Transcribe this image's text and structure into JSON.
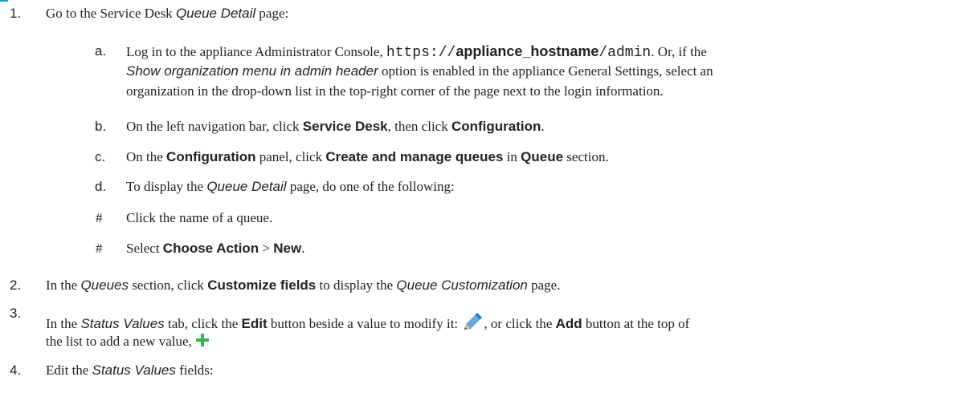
{
  "steps": {
    "s1": {
      "num": "1.",
      "text_a": "Go to the Service Desk ",
      "text_b": "Queue Detail",
      "text_c": " page:"
    },
    "a": {
      "label": "a.",
      "l1_a": "Log in to the appliance Administrator Console, ",
      "l1_url1": "https://",
      "l1_url2": "appliance_hostname",
      "l1_url3": "/admin",
      "l1_b": ". Or, if the",
      "l2_a": "Show organization menu in admin header",
      "l2_b": " option is enabled in the appliance General Settings, select an",
      "l3": "organization in the drop-down list in the top-right corner of the page next to the login information."
    },
    "b": {
      "label": "b.",
      "t1": "On the left navigation bar, click ",
      "t2": "Service Desk",
      "t3": ", then click ",
      "t4": "Configuration",
      "t5": "."
    },
    "c": {
      "label": "c.",
      "t1": "On the ",
      "t2": "Configuration",
      "t3": " panel, click ",
      "t4": "Create and manage queues",
      "t5": " in ",
      "t6": "Queue",
      "t7": " section."
    },
    "d": {
      "label": "d.",
      "t1": "To display the ",
      "t2": "Queue Detail",
      "t3": " page, do one of the following:"
    },
    "bullet1": {
      "mark": "#",
      "text": "Click the name of a queue."
    },
    "bullet2": {
      "mark": "#",
      "t1": "Select ",
      "t2": "Choose Action",
      "t3": " > ",
      "t4": "New",
      "t5": "."
    },
    "s2": {
      "num": "2.",
      "t1": "In the ",
      "t2": "Queues",
      "t3": " section, click ",
      "t4": "Customize fields",
      "t5": " to display the ",
      "t6": "Queue Customization",
      "t7": " page."
    },
    "s3": {
      "num": "3.",
      "t1": "In the ",
      "t2": "Status Values",
      "t3": " tab, click the ",
      "t4": "Edit",
      "t5": " button beside a value to modify it: ",
      "t6": ", or click the ",
      "t7": "Add",
      "t8": " button at the top of",
      "l2": "the list to add a new value, "
    },
    "s4": {
      "num": "4.",
      "t1": "Edit the ",
      "t2": "Status Values",
      "t3": " fields:"
    }
  },
  "icons": {
    "edit": "pencil-icon",
    "add": "plus-icon"
  },
  "colors": {
    "accent": "#1c9ad6",
    "add_green": "#3bb34a",
    "pencil_blue": "#5b9bd5"
  }
}
